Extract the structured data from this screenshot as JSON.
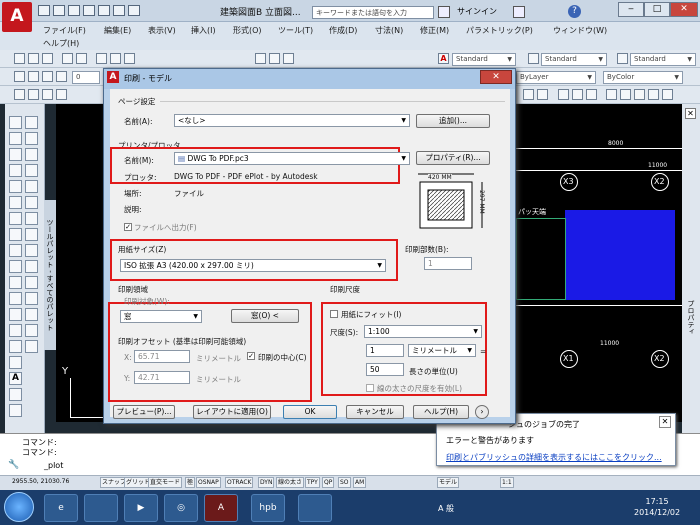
{
  "app": {
    "title": "建築図面B  立面図...",
    "search_placeholder": "キーワードまたは語句を入力",
    "signin": "サインイン"
  },
  "menu": [
    "ファイル(F)",
    "編集(E)",
    "表示(V)",
    "挿入(I)",
    "形式(O)",
    "ツール(T)",
    "作成(D)",
    "寸法(N)",
    "修正(M)",
    "パラメトリック(P)",
    "ウィンドウ(W)",
    "ヘルプ(H)"
  ],
  "toolbar": {
    "style1": "Standard",
    "style2": "Standard",
    "style3": "Standard",
    "layer_value": "0",
    "bylayer": "ByLayer",
    "bycolor": "ByColor"
  },
  "palettes": {
    "left_title": "ツールパレット - すべてのパレット",
    "right_title": "プロパティ"
  },
  "drawing": {
    "labels": [
      "X3",
      "X2",
      "X1",
      "X2"
    ],
    "dim_values": [
      "8000",
      "11000",
      "11000"
    ],
    "note": "パッ天端",
    "y_axis": "Y"
  },
  "dialog": {
    "title": "印刷 - モデル",
    "page_setup_group": "ページ設定",
    "name_label": "名前(A):",
    "name_value": "<なし>",
    "add_button": "追加()...",
    "printer_group": "プリンタ/プロッタ",
    "printer_name_label": "名前(M):",
    "printer_name_value": "DWG To PDF.pc3",
    "properties_button": "プロパティ(R)...",
    "plotter_label": "プロッタ:",
    "plotter_value": "DWG To PDF - PDF ePlot - by Autodesk",
    "location_label": "場所:",
    "location_value": "ファイル",
    "description_label": "説明:",
    "print_to_file": "ファイルへ出力(F)",
    "paper_dim_width": "420 MM",
    "paper_dim_height": "297 MM",
    "paper_size_label": "用紙サイズ(Z)",
    "paper_size_value": "ISO 拡張 A3 (420.00 x 297.00 ミリ)",
    "copies_label": "印刷部数(B):",
    "copies_value": "1",
    "plot_area_group": "印刷領域",
    "plot_target_label": "印刷対象(W):",
    "plot_target_value": "窓",
    "window_button": "窓(O) <",
    "scale_group": "印刷尺度",
    "fit_to_paper": "用紙にフィット(I)",
    "scale_label": "尺度(S):",
    "scale_value": "1:100",
    "scale_num": "1",
    "scale_unit": "ミリメートル",
    "scale_den": "50",
    "unit_length_label": "長さの単位(U)",
    "lineweight_scale": "線の太さの尺度を有効(L)",
    "offset_group": "印刷オフセット (基準は印刷可能領域)",
    "x_label": "X:",
    "x_value": "65.71",
    "x_unit": "ミリメートル",
    "y_label": "Y:",
    "y_value": "42.71",
    "y_unit": "ミリメートル",
    "center_plot": "印刷の中心(C)",
    "preview_button": "プレビュー(P)...",
    "apply_layout_button": "レイアウトに適用(O)",
    "ok_button": "OK",
    "cancel_button": "キャンセル",
    "help_button": "ヘルプ(H)"
  },
  "command": {
    "line1": "コマンド:",
    "line2": "コマンド:",
    "input": "_plot"
  },
  "status": {
    "coords": "2955.50, 21030.76",
    "items": [
      "スナップ",
      "グリッド",
      "直交モード",
      "極",
      "OSNAP",
      "OTRACK",
      "DYN",
      "線の太さ",
      "TPY",
      "QP",
      "SO",
      "AM"
    ],
    "model": "モデル",
    "scale": "1:1"
  },
  "notification": {
    "title": "シュのジョブの完了",
    "message": "エラーと警告があります",
    "link": "印刷とパブリッシュの詳細を表示するにはここをクリック..."
  },
  "taskbar": {
    "time": "17:15",
    "date": "2014/12/02",
    "ime": "A 般"
  }
}
